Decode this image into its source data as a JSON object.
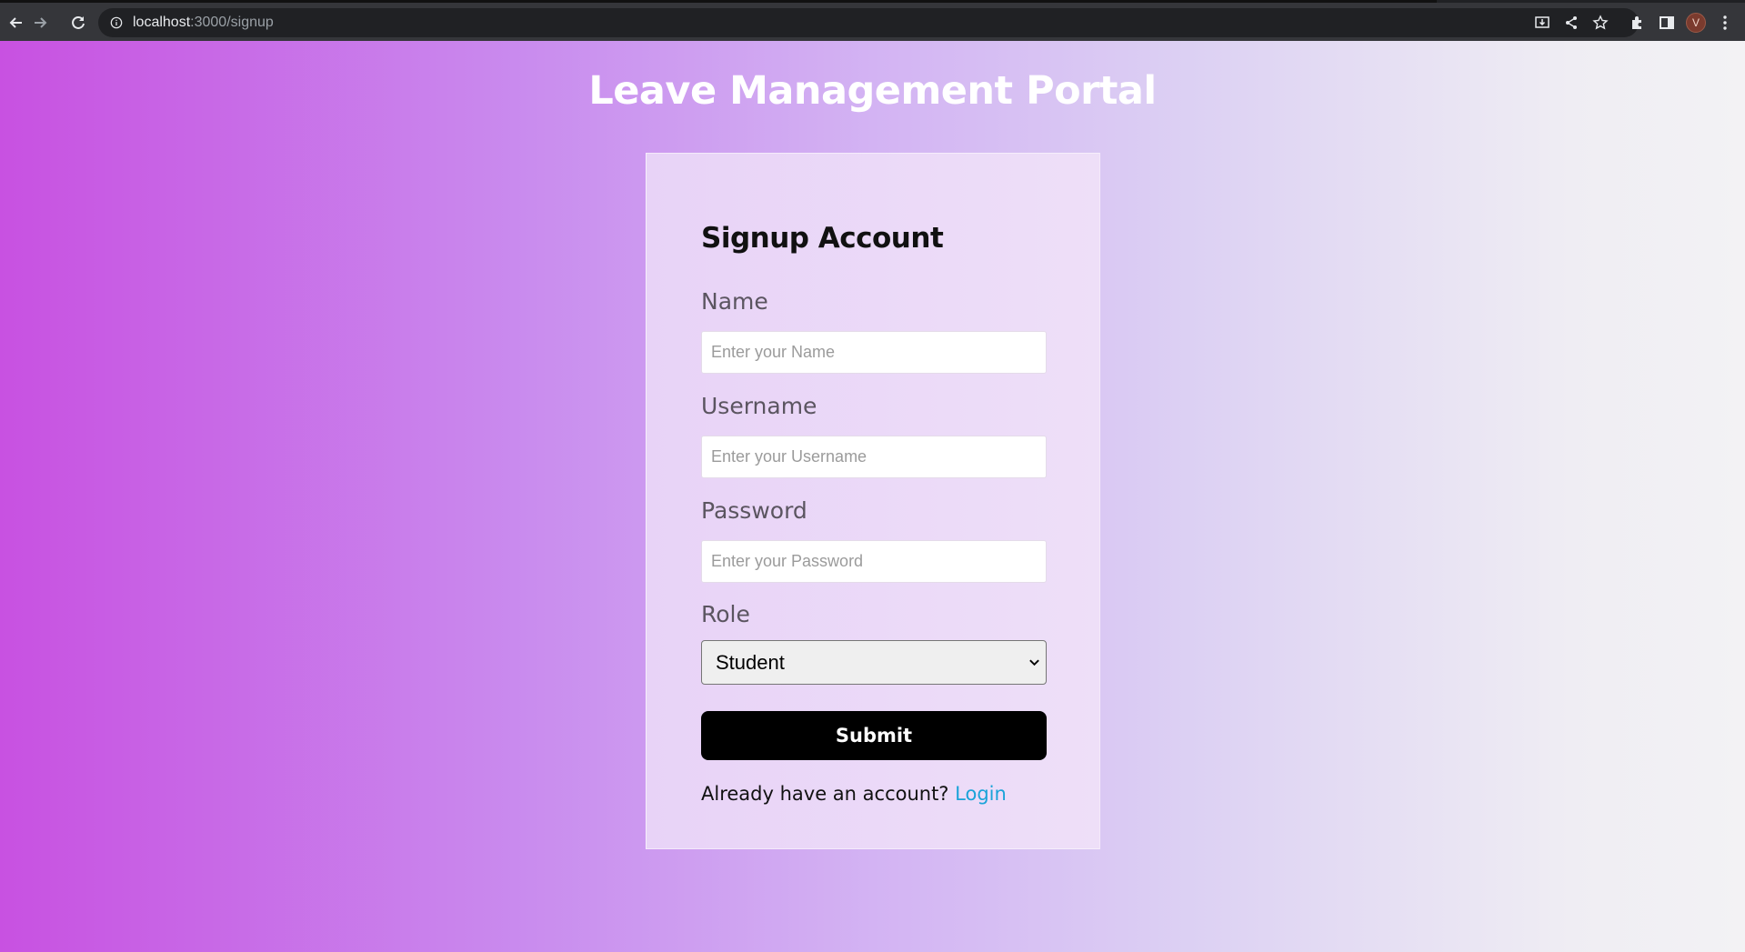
{
  "browser": {
    "url_host": "localhost",
    "url_rest": ":3000/signup",
    "avatar_initial": "V"
  },
  "page": {
    "title": "Leave Management Portal"
  },
  "form": {
    "heading": "Signup Account",
    "name": {
      "label": "Name",
      "placeholder": "Enter your Name",
      "value": ""
    },
    "username": {
      "label": "Username",
      "placeholder": "Enter your Username",
      "value": ""
    },
    "password": {
      "label": "Password",
      "placeholder": "Enter your Password",
      "value": ""
    },
    "role": {
      "label": "Role",
      "selected": "Student"
    },
    "submit_label": "Submit",
    "login_prompt": "Already have an account?",
    "login_link": "Login"
  },
  "colors": {
    "gradient_start": "#c851e1",
    "gradient_end": "#f3f2f4",
    "card_bg": "#ebd9f7",
    "button_bg": "#000000",
    "link": "#1aa3d9"
  }
}
